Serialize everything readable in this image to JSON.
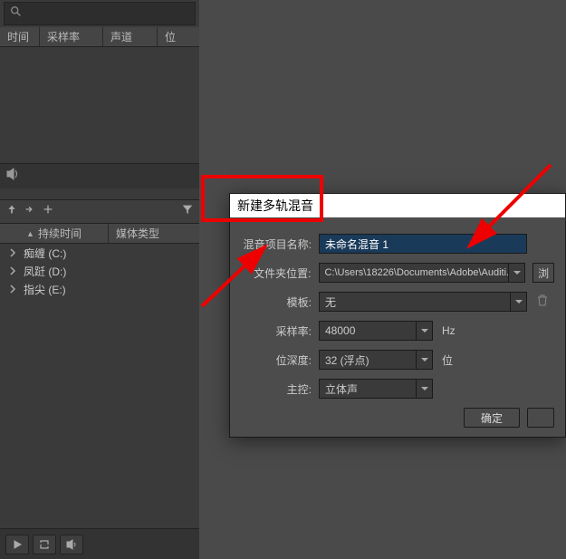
{
  "top_panel": {
    "columns": [
      "时间",
      "采样率",
      "声道",
      "位"
    ]
  },
  "bottom_panel": {
    "col_duration": "持续时间",
    "col_media_type": "媒体类型",
    "drives": [
      {
        "label": "痴缠 (C:)"
      },
      {
        "label": "凤跹 (D:)"
      },
      {
        "label": "指尖 (E:)"
      }
    ]
  },
  "dialog": {
    "title": "新建多轨混音",
    "labels": {
      "name": "混音项目名称:",
      "folder": "文件夹位置:",
      "template": "模板:",
      "sample_rate": "采样率:",
      "bit_depth": "位深度:",
      "master": "主控:"
    },
    "values": {
      "name": "未命名混音 1",
      "folder": "C:\\Users\\18226\\Documents\\Adobe\\Auditi...",
      "template": "无",
      "sample_rate": "48000",
      "bit_depth": "32 (浮点)",
      "master": "立体声"
    },
    "units": {
      "hz": "Hz",
      "bit": "位"
    },
    "browse": "浏",
    "ok": "确定"
  }
}
